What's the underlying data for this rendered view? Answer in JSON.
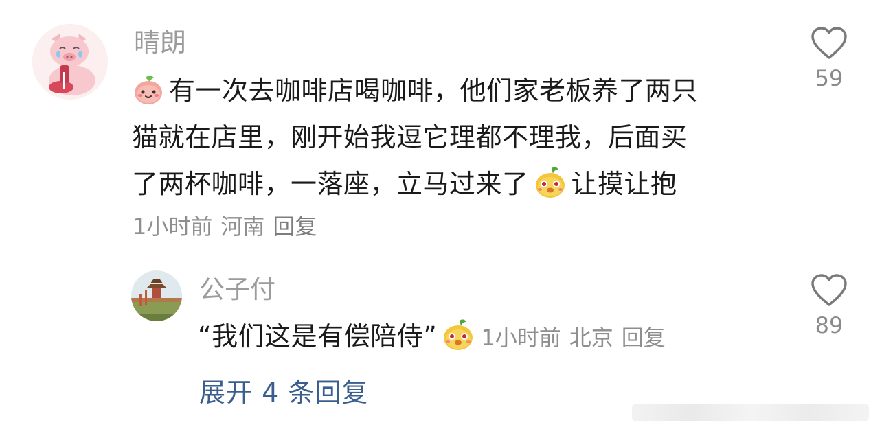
{
  "comment": {
    "username": "晴朗",
    "avatar_icon": "pig-avatar",
    "body_lines": [
      "有一次去咖啡店喝咖啡，他们家老板养了两只",
      "猫就在店里，刚开始我逗它理都不理我，后面买",
      "了两杯咖啡，一落座，立马过来了"
    ],
    "body_suffix": "让摸让抱",
    "leading_emoji": "smiling-peach-emoji",
    "inline_emoji": "yellow-bird-emoji",
    "time": "1小时前",
    "location": "河南",
    "reply_label": "回复",
    "like_count": "59"
  },
  "reply": {
    "username": "公子付",
    "avatar_icon": "palace-photo-avatar",
    "text": "“我们这是有偿陪侍”",
    "emoji": "yellow-bird-emoji",
    "time": "1小时前",
    "location": "北京",
    "reply_label": "回复",
    "like_count": "89"
  },
  "expand": {
    "label": "展开 4 条回复"
  },
  "colors": {
    "username": "#9b9b9b",
    "text": "#1a1a1a",
    "meta": "#8e8e8e",
    "link": "#3a5f8e"
  }
}
